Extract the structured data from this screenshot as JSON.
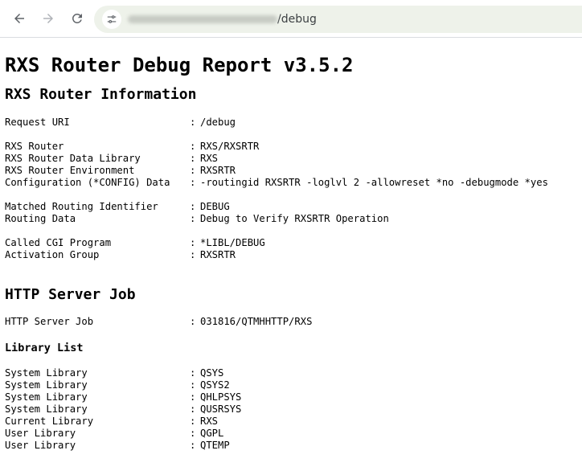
{
  "browser": {
    "url_path": "/debug"
  },
  "page": {
    "title": "RXS Router Debug Report v3.5.2",
    "router_info": {
      "heading": "RXS Router Information",
      "groups": [
        [
          {
            "key": "Request URI",
            "value": "/debug"
          }
        ],
        [
          {
            "key": "RXS Router",
            "value": "RXS/RXSRTR"
          },
          {
            "key": "RXS Router Data Library",
            "value": "RXS"
          },
          {
            "key": "RXS Router Environment",
            "value": "RXSRTR"
          },
          {
            "key": "Configuration (*CONFIG) Data",
            "value": "-routingid RXSRTR -loglvl 2 -allowreset *no -debugmode *yes"
          }
        ],
        [
          {
            "key": "Matched Routing Identifier",
            "value": "DEBUG"
          },
          {
            "key": "Routing Data",
            "value": "Debug to Verify RXSRTR Operation"
          }
        ],
        [
          {
            "key": "Called CGI Program",
            "value": "*LIBL/DEBUG"
          },
          {
            "key": "Activation Group",
            "value": "RXSRTR"
          }
        ]
      ]
    },
    "http_job": {
      "heading": "HTTP Server Job",
      "key": "HTTP Server Job",
      "value": "031816/QTMHHTTP/RXS"
    },
    "library_list": {
      "heading": "Library List",
      "items": [
        {
          "key": "System Library",
          "value": "QSYS"
        },
        {
          "key": "System Library",
          "value": "QSYS2"
        },
        {
          "key": "System Library",
          "value": "QHLPSYS"
        },
        {
          "key": "System Library",
          "value": "QUSRSYS"
        },
        {
          "key": "Current Library",
          "value": "RXS"
        },
        {
          "key": "User Library",
          "value": "QGPL"
        },
        {
          "key": "User Library",
          "value": "QTEMP"
        }
      ]
    },
    "separator": ":"
  }
}
